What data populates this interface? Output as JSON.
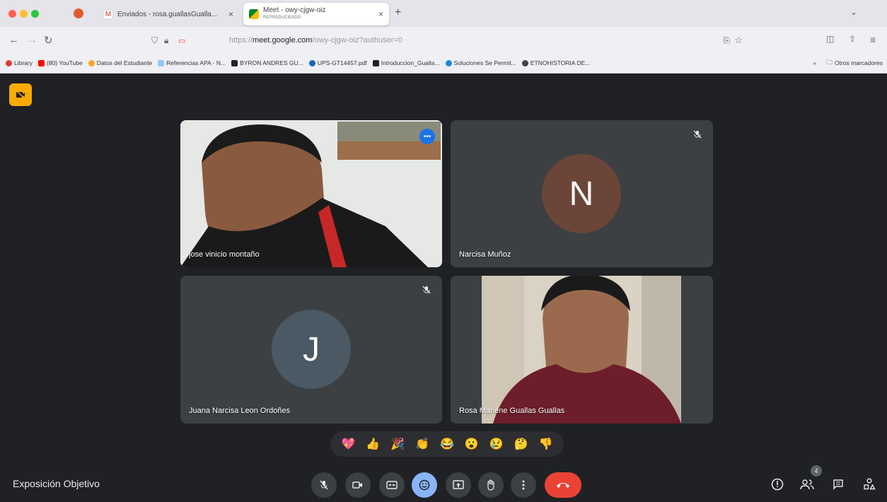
{
  "browser": {
    "tabs": [
      {
        "label": "Enviados - rosa.guallasGualla...",
        "icon": "gmail-icon"
      },
      {
        "label": "Meet - owy-cjgw-oiz",
        "sublabel": "REPRODUCIENDO",
        "icon": "meet-icon"
      }
    ],
    "new_tab_label": "+",
    "url_prefix": "https://",
    "url_domain": "meet.google.com",
    "url_path": "/owy-cjgw-oiz?authuser=0",
    "bookmarks": [
      {
        "label": "Library",
        "color": "#e53935"
      },
      {
        "label": "(80) YouTube",
        "color": "#ff0000"
      },
      {
        "label": "Datos del Estudiante",
        "color": "#f9a825"
      },
      {
        "label": "Referencias APA - N...",
        "color": "#90caf9"
      },
      {
        "label": "BYRON ANDRES GU...",
        "color": "#212121"
      },
      {
        "label": "UPS-GT14457.pdf",
        "color": "#1565c0"
      },
      {
        "label": "Introduccion_Gualla...",
        "color": "#212121"
      },
      {
        "label": "Soluciones Se Permit...",
        "color": "#1e88e5"
      },
      {
        "label": "ETNOHISTORIA DE...",
        "color": "#424242"
      }
    ],
    "bookmarks_overflow": "»",
    "other_bookmarks": "Otros marcadores"
  },
  "meet": {
    "participants": [
      {
        "name": "jose vinicio montaño",
        "type": "video",
        "active": true
      },
      {
        "name": "Narcisa Muñoz",
        "type": "avatar",
        "initial": "N",
        "avatar_color": "#6b4537",
        "muted": true
      },
      {
        "name": "Juana Narcisa Leon Ordoñes",
        "type": "avatar",
        "initial": "J",
        "avatar_color": "#4a5964",
        "muted": true
      },
      {
        "name": "Rosa Marlene Guallas Guallas",
        "type": "video"
      }
    ],
    "reactions": [
      "💖",
      "👍",
      "🎉",
      "👏",
      "😂",
      "😮",
      "😢",
      "🤔",
      "👎"
    ],
    "meeting_title": "Exposición Objetivo",
    "participant_count": "4",
    "more_options_label": "•••"
  }
}
